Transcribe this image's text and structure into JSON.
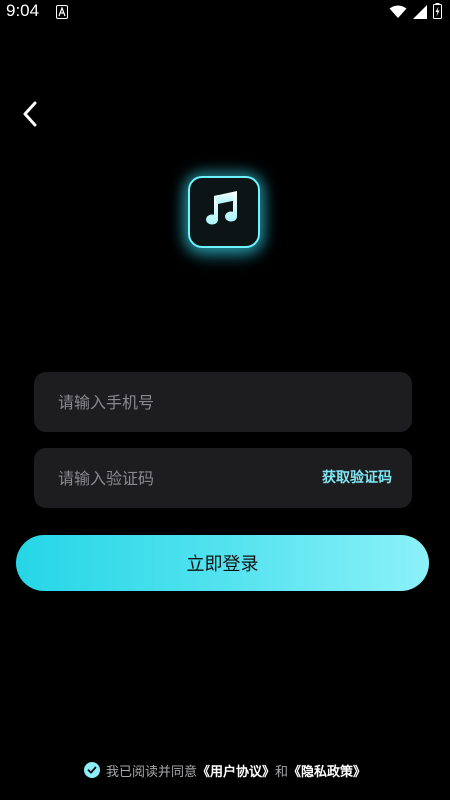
{
  "status_bar": {
    "time": "9:04"
  },
  "login": {
    "phone_placeholder": "请输入手机号",
    "code_placeholder": "请输入验证码",
    "get_code_label": "获取验证码",
    "login_button_label": "立即登录"
  },
  "agreement": {
    "prefix": "我已阅读并同意",
    "user_agreement": "《用户协议》",
    "connector": "和",
    "privacy_policy": "《隐私政策》",
    "checked": true
  },
  "colors": {
    "accent": "#4adfee",
    "background": "#000000",
    "field_background": "#1d1d1f"
  },
  "icons": {
    "back": "chevron-left-icon",
    "logo": "music-note-icon",
    "wifi": "wifi-icon",
    "signal": "signal-icon",
    "battery": "battery-icon"
  }
}
